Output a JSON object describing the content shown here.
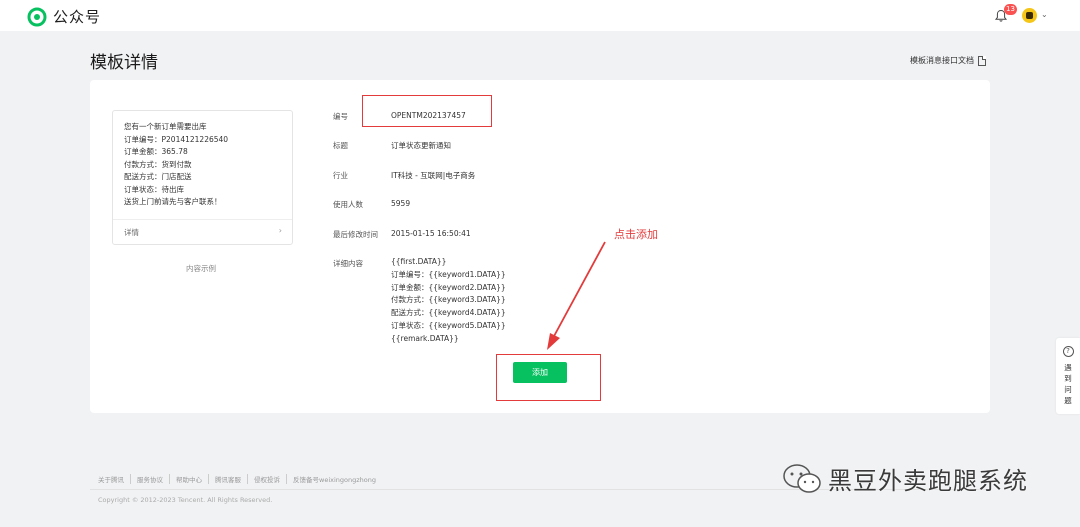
{
  "topbar": {
    "app_name": "公众号",
    "notification_count": "13"
  },
  "page": {
    "title": "模板详情",
    "doc_link": "模板消息接口文档"
  },
  "preview": {
    "lines": [
      "您有一个新订单需要出库",
      "订单编号：P2014121226540",
      "订单金额：365.78",
      "付款方式：货到付款",
      "配送方式：门店配送",
      "订单状态：待出库",
      "送货上门前请先与客户联系！"
    ],
    "detail_label": "详情",
    "caption": "内容示例"
  },
  "template": {
    "fields": {
      "id": {
        "label": "编号",
        "value": "OPENTM202137457"
      },
      "title": {
        "label": "标题",
        "value": "订单状态更新通知"
      },
      "industry": {
        "label": "行业",
        "value": "IT科技 - 互联网|电子商务"
      },
      "usage": {
        "label": "使用人数",
        "value": "5959"
      },
      "modified": {
        "label": "最后修改时间",
        "value": "2015-01-15 16:50:41"
      }
    },
    "content_label": "详细内容",
    "content_lines": [
      "{{first.DATA}}",
      "订单编号：{{keyword1.DATA}}",
      "订单金额：{{keyword2.DATA}}",
      "付款方式：{{keyword3.DATA}}",
      "配送方式：{{keyword4.DATA}}",
      "订单状态：{{keyword5.DATA}}",
      "{{remark.DATA}}"
    ],
    "add_button": "添加"
  },
  "annotation": {
    "text": "点击添加",
    "color": "#e33b3b"
  },
  "help": {
    "text": "遇到问题"
  },
  "footer": {
    "links": [
      "关于腾讯",
      "服务协议",
      "帮助中心",
      "腾讯客服",
      "侵权投诉",
      "反馈备号weixingongzhong"
    ],
    "copyright": "Copyright © 2012-2023 Tencent. All Rights Reserved."
  },
  "watermark": {
    "text": "黑豆外卖跑腿系统"
  },
  "colors": {
    "brand_green": "#07c160",
    "badge_red": "#fa5151"
  }
}
